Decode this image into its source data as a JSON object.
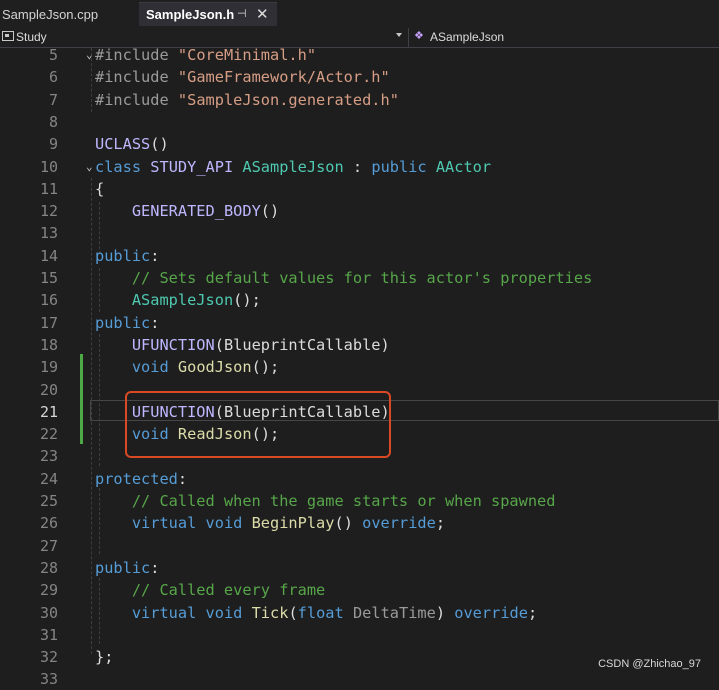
{
  "tabs": [
    {
      "label": "SampleJson.cpp",
      "active": false
    },
    {
      "label": "SampleJson.h",
      "active": true,
      "pin_icon": "pin-icon",
      "close_icon": "close-icon"
    }
  ],
  "nav": {
    "project": "Study",
    "scope": "ASampleJson"
  },
  "colors": {
    "keyword": "#569cd6",
    "type": "#4ec9b0",
    "function": "#dcdcaa",
    "macro": "#beb7ff",
    "comment": "#57a64a",
    "string": "#d69d85",
    "highlight_box": "#d94a24",
    "git_added": "#4ca946"
  },
  "editor": {
    "current_line": 21,
    "lines": [
      {
        "n": "5",
        "t": "#include \"CoreMinimal.h\""
      },
      {
        "n": "6",
        "t": "#include \"GameFramework/Actor.h\""
      },
      {
        "n": "7",
        "t": "#include \"SampleJson.generated.h\""
      },
      {
        "n": "8",
        "t": ""
      },
      {
        "n": "9",
        "t": "UCLASS()"
      },
      {
        "n": "10",
        "t": "class STUDY_API ASampleJson : public AActor"
      },
      {
        "n": "11",
        "t": "{"
      },
      {
        "n": "12",
        "t": "    GENERATED_BODY()"
      },
      {
        "n": "13",
        "t": ""
      },
      {
        "n": "14",
        "t": "public:"
      },
      {
        "n": "15",
        "t": "    // Sets default values for this actor's properties"
      },
      {
        "n": "16",
        "t": "    ASampleJson();"
      },
      {
        "n": "17",
        "t": "public:"
      },
      {
        "n": "18",
        "t": "    UFUNCTION(BlueprintCallable)"
      },
      {
        "n": "19",
        "t": "    void GoodJson();"
      },
      {
        "n": "20",
        "t": ""
      },
      {
        "n": "21",
        "t": "    UFUNCTION(BlueprintCallable)"
      },
      {
        "n": "22",
        "t": "    void ReadJson();"
      },
      {
        "n": "23",
        "t": ""
      },
      {
        "n": "24",
        "t": "protected:"
      },
      {
        "n": "25",
        "t": "    // Called when the game starts or when spawned"
      },
      {
        "n": "26",
        "t": "    virtual void BeginPlay() override;"
      },
      {
        "n": "27",
        "t": ""
      },
      {
        "n": "28",
        "t": "public:"
      },
      {
        "n": "29",
        "t": "    // Called every frame"
      },
      {
        "n": "30",
        "t": "    virtual void Tick(float DeltaTime) override;"
      },
      {
        "n": "31",
        "t": ""
      },
      {
        "n": "32",
        "t": "};"
      },
      {
        "n": "33",
        "t": ""
      }
    ]
  },
  "watermark": "CSDN @Zhichao_97"
}
